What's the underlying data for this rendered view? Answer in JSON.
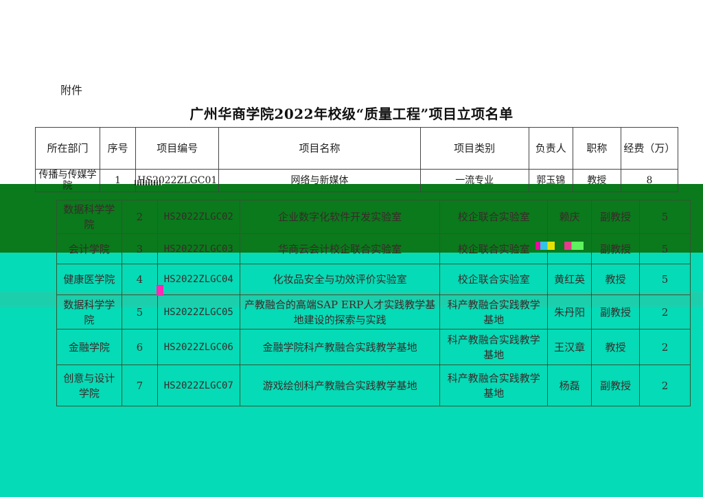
{
  "attachment_label": "附件",
  "title": "广州华商学院2022年校级“质量工程”项目立项名单",
  "headers": [
    "所在部门",
    "序号",
    "项目编号",
    "项目名称",
    "项目类别",
    "负责人",
    "职称",
    "经费（万）"
  ],
  "rows": [
    {
      "dept": "传播与传媒学院",
      "no": "1",
      "code": "HS2022ZLGC01",
      "name": "网络与新媒体",
      "category": "一流专业",
      "leader": "郭玉锦",
      "titlerank": "教授",
      "funds": "8"
    },
    {
      "dept": "数据科学学院",
      "no": "2",
      "code": "HS2022ZLGC02",
      "name": "企业数字化软件开发实验室",
      "category": "校企联合实验室",
      "leader": "赖庆",
      "titlerank": "副教授",
      "funds": "5"
    },
    {
      "dept": "会计学院",
      "no": "3",
      "code": "HS2022ZLGC03",
      "name": "华商云会计校企联合实验室",
      "category": "校企联合实验室",
      "leader": "",
      "titlerank": "副教授",
      "funds": "5"
    },
    {
      "dept": "健康医学院",
      "no": "4",
      "code": "HS2022ZLGC04",
      "name": "化妆品安全与功效评价实验室",
      "category": "校企联合实验室",
      "leader": "黄红英",
      "titlerank": "教授",
      "funds": "5"
    },
    {
      "dept": "数据科学学院",
      "no": "5",
      "code": "HS2022ZLGC05",
      "name": "产教融合的高端SAP ERP人才实践教学基地建设的探索与实践",
      "category": "科产教融合实践教学基地",
      "leader": "朱丹阳",
      "titlerank": "副教授",
      "funds": "2"
    },
    {
      "dept": "金融学院",
      "no": "6",
      "code": "HS2022ZLGC06",
      "name": "金融学院科产教融合实践教学基地",
      "category": "科产教融合实践教学基地",
      "leader": "王汉章",
      "titlerank": "教授",
      "funds": "2"
    },
    {
      "dept": "创意与设计学院",
      "no": "7",
      "code": "HS2022ZLGC07",
      "name": "游戏绘创科产教融合实践教学基地",
      "category": "科产教融合实践教学基地",
      "leader": "杨磊",
      "titlerank": "副教授",
      "funds": "2"
    }
  ]
}
